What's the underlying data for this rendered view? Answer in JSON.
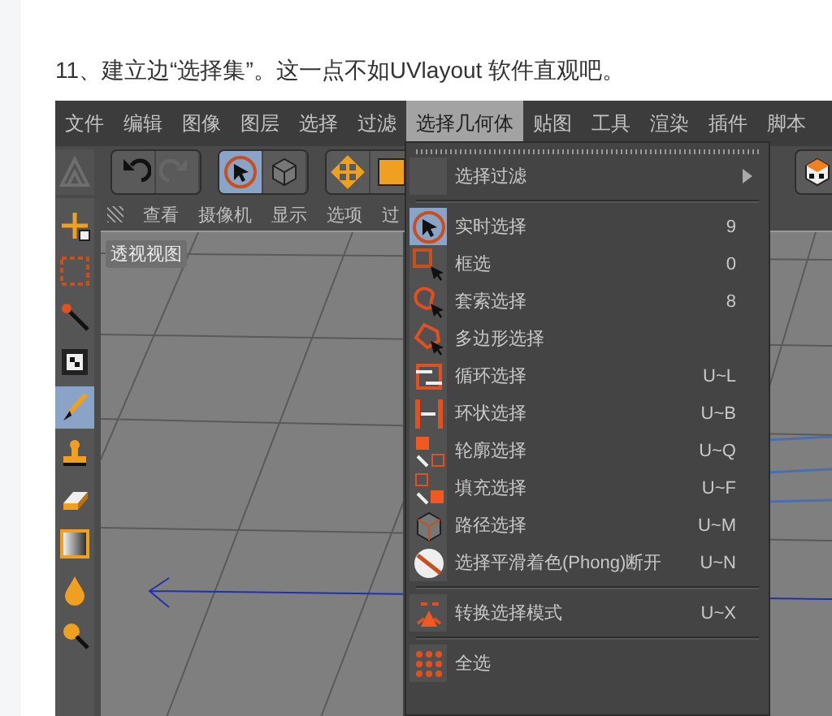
{
  "article": {
    "heading": "11、建立边“选择集”。这一点不如UVlayout 软件直观吧。"
  },
  "app": {
    "menu_bar": [
      {
        "label": "文件",
        "selected": false
      },
      {
        "label": "编辑",
        "selected": false
      },
      {
        "label": "图像",
        "selected": false
      },
      {
        "label": "图层",
        "selected": false
      },
      {
        "label": "选择",
        "selected": false
      },
      {
        "label": "过滤",
        "selected": false
      },
      {
        "label": "选择几何体",
        "selected": true
      },
      {
        "label": "贴图",
        "selected": false
      },
      {
        "label": "工具",
        "selected": false
      },
      {
        "label": "渲染",
        "selected": false
      },
      {
        "label": "插件",
        "selected": false
      },
      {
        "label": "脚本",
        "selected": false
      }
    ],
    "toolbar": [
      {
        "selected": false
      },
      {
        "selected": false
      },
      {
        "selected": true
      },
      {
        "selected": false
      },
      {
        "selected": false
      },
      {
        "selected": false
      }
    ],
    "left_tools": [
      {
        "selected": false
      },
      {
        "selected": false
      },
      {
        "selected": false
      },
      {
        "selected": false
      },
      {
        "selected": true
      },
      {
        "selected": false
      },
      {
        "selected": false
      },
      {
        "selected": false
      },
      {
        "selected": false
      },
      {
        "selected": false
      }
    ],
    "viewport_tabs": [
      "查看",
      "摄像机",
      "显示",
      "选项",
      "过"
    ],
    "viewport_label": "透视视图",
    "dropdown": [
      {
        "kind": "submenu",
        "label": "选择过滤"
      },
      {
        "kind": "separator"
      },
      {
        "kind": "item",
        "label": "实时选择",
        "shortcut": "9",
        "selected": true
      },
      {
        "kind": "item",
        "label": "框选",
        "shortcut": "0",
        "selected": false
      },
      {
        "kind": "item",
        "label": "套索选择",
        "shortcut": "8",
        "selected": false
      },
      {
        "kind": "item",
        "label": "多边形选择",
        "selected": false
      },
      {
        "kind": "item",
        "label": "循环选择",
        "shortcut": "U~L",
        "selected": false
      },
      {
        "kind": "item",
        "label": "环状选择",
        "shortcut": "U~B",
        "selected": false
      },
      {
        "kind": "item",
        "label": "轮廓选择",
        "shortcut": "U~Q",
        "selected": false
      },
      {
        "kind": "item",
        "label": "填充选择",
        "shortcut": "U~F",
        "selected": false
      },
      {
        "kind": "item",
        "label": "路径选择",
        "shortcut": "U~M",
        "selected": false
      },
      {
        "kind": "item",
        "label": "选择平滑着色(Phong)断开",
        "shortcut": "U~N",
        "selected": false
      },
      {
        "kind": "separator"
      },
      {
        "kind": "item",
        "label": "转换选择模式",
        "shortcut": "U~X",
        "selected": false
      },
      {
        "kind": "separator"
      },
      {
        "kind": "item",
        "label": "全选",
        "selected": false
      }
    ]
  }
}
